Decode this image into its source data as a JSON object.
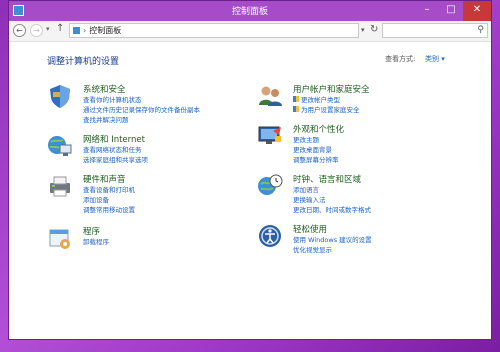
{
  "window": {
    "title": "控制面板",
    "min_label": "–",
    "max_label": "□",
    "close_label": "✕"
  },
  "nav": {
    "back": "←",
    "forward": "→",
    "recent": "▾",
    "up": "↑",
    "address": "控制面板",
    "address_sep": "›",
    "address_dropdown": "▾",
    "refresh": "↻",
    "search_placeholder": "",
    "search_icon": "⚲"
  },
  "main": {
    "heading": "调整计算机的设置",
    "view_by_label": "查看方式:",
    "view_by_value": "类别 ▾"
  },
  "categories": [
    {
      "title": "系统和安全",
      "icon": "shield-icon",
      "links": [
        "查看你的计算机状态",
        "通过文件历史记录保存你的文件备份副本",
        "查找并解决问题"
      ]
    },
    {
      "title": "网络和 Internet",
      "icon": "network-icon",
      "links": [
        "查看网络状态和任务",
        "选择家庭组和共享选项"
      ]
    },
    {
      "title": "硬件和声音",
      "icon": "printer-icon",
      "links": [
        "查看设备和打印机",
        "添加设备",
        "调整常用移动设置"
      ]
    },
    {
      "title": "程序",
      "icon": "programs-icon",
      "links": [
        "卸载程序"
      ]
    },
    {
      "title": "用户帐户和家庭安全",
      "icon": "users-icon",
      "links": [
        "更改帐户类型",
        "为用户设置家庭安全"
      ]
    },
    {
      "title": "外观和个性化",
      "icon": "appearance-icon",
      "links": [
        "更改主题",
        "更改桌面背景",
        "调整屏幕分辨率"
      ]
    },
    {
      "title": "时钟、语言和区域",
      "icon": "clock-globe-icon",
      "links": [
        "添加语言",
        "更换输入法",
        "更改日期、时间或数字格式"
      ]
    },
    {
      "title": "轻松使用",
      "icon": "ease-of-access-icon",
      "links": [
        "使用 Windows 建议的设置",
        "优化视觉显示"
      ]
    }
  ]
}
